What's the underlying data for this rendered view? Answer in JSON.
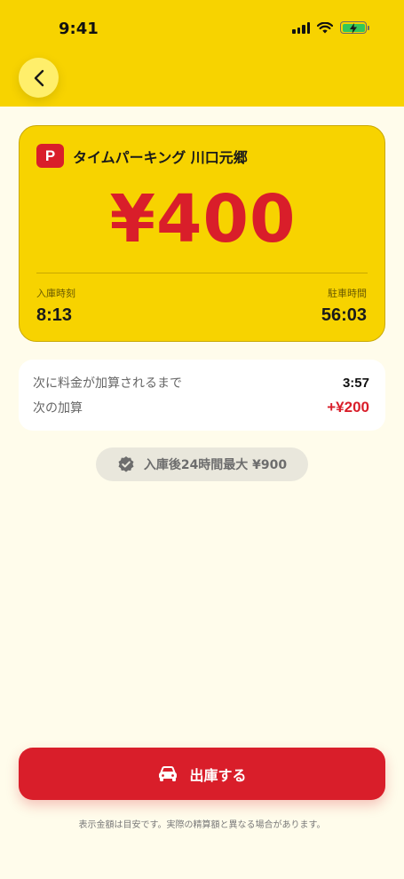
{
  "status_bar": {
    "time": "9:41"
  },
  "navigation": {
    "back_icon": "chevron-left-icon"
  },
  "parking": {
    "badge": "P",
    "lot_name": "タイムパーキング 川口元郷",
    "price": "¥400",
    "entry_label": "入庫時刻",
    "entry_time": "8:13",
    "duration_label": "駐車時間",
    "duration": "56:03"
  },
  "next_charge": {
    "until_label": "次に料金が加算されるまで",
    "until_value": "3:57",
    "increment_label": "次の加算",
    "increment_value": "+¥200"
  },
  "cap": {
    "icon": "verified-badge-icon",
    "text": "入庫後24時間最大 ¥900"
  },
  "exit": {
    "icon": "car-icon",
    "label": "出庫する"
  },
  "footnote": "表示金額は目安です。実際の精算額と異なる場合があります。",
  "colors": {
    "header_yellow": "#F7D300",
    "accent_red": "#D91E2A",
    "background": "#FFFCEB"
  }
}
